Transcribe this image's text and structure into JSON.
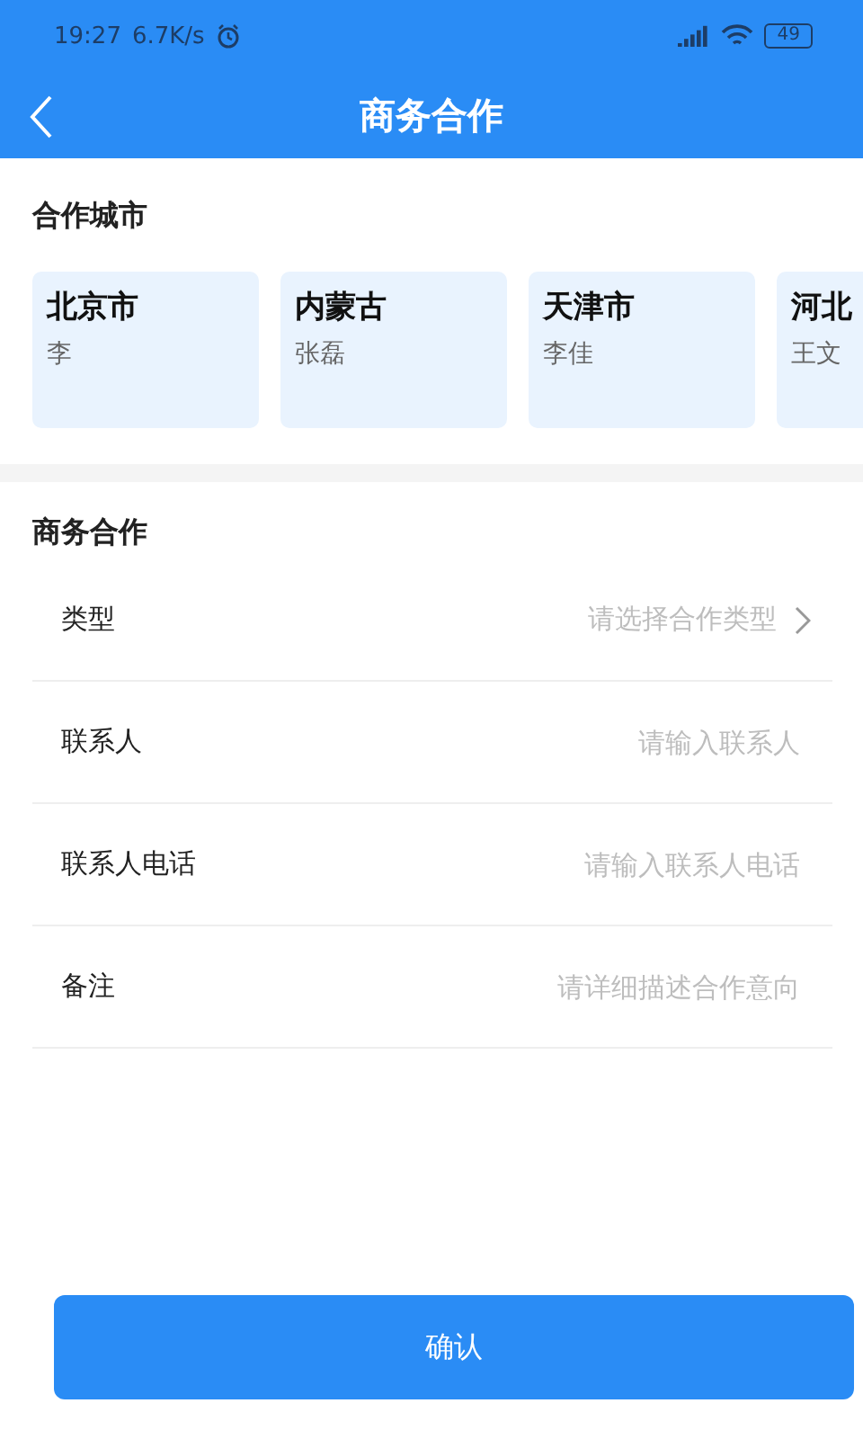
{
  "status_bar": {
    "time": "19:27",
    "speed": "6.7K/s",
    "battery": "49"
  },
  "header": {
    "title": "商务合作"
  },
  "cities": {
    "title": "合作城市",
    "items": [
      {
        "name": "北京市",
        "contact": "李"
      },
      {
        "name": "内蒙古",
        "contact": "张磊"
      },
      {
        "name": "天津市",
        "contact": "李佳"
      },
      {
        "name": "河北",
        "contact": "王文"
      }
    ]
  },
  "form": {
    "title": "商务合作",
    "rows": [
      {
        "kind": "select",
        "label": "类型",
        "placeholder": "请选择合作类型"
      },
      {
        "kind": "input",
        "label": "联系人",
        "placeholder": "请输入联系人"
      },
      {
        "kind": "input",
        "label": "联系人电话",
        "placeholder": "请输入联系人电话"
      },
      {
        "kind": "input",
        "label": "备注",
        "placeholder": "请详细描述合作意向"
      }
    ]
  },
  "confirm_button": "确认"
}
